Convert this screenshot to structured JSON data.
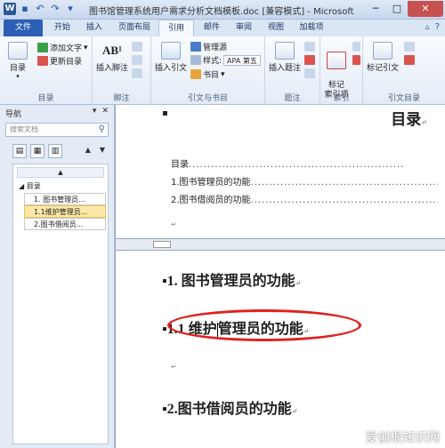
{
  "window": {
    "title": "图书馆管理系统用户需求分析文档模板.doc [兼容模式] - Microsoft Word",
    "logo": "W"
  },
  "tabs": {
    "file": "文件",
    "items": [
      "开始",
      "插入",
      "页面布局",
      "引用",
      "邮件",
      "审阅",
      "视图",
      "加载项"
    ],
    "active": "引用"
  },
  "ribbon": {
    "toc_group": {
      "label": "目录",
      "toc_button": "目录",
      "add_text": "添加文字",
      "update_toc": "更新目录"
    },
    "footnote_group": {
      "label": "脚注",
      "insert_footnote": "插入脚注"
    },
    "citations_group": {
      "label": "引文与书目",
      "insert_citation": "插入引文",
      "manage_sources": "管理源",
      "style_label": "样式:",
      "style_value": "APA 第五",
      "bibliography": "书目"
    },
    "captions_group": {
      "label": "题注",
      "insert_caption": "插入题注"
    },
    "index_group": {
      "label": "索引",
      "mark_entry": "标记\n索引项"
    },
    "toa_group": {
      "label": "引文目录",
      "mark_citation": "标记引文"
    }
  },
  "nav": {
    "title": "导航",
    "search_placeholder": "搜索文档",
    "tree": {
      "root": "目录",
      "items": [
        {
          "label": "1. 图书管理员...",
          "selected": false
        },
        {
          "label": "1.1维护管理员...",
          "selected": true
        },
        {
          "label": "2.图书借阅员...",
          "selected": false
        }
      ]
    }
  },
  "document": {
    "toc_heading": "目录",
    "toc_entries": [
      {
        "text": "目录",
        "page": ""
      },
      {
        "text": "1.图书管理员的功能",
        "page": ""
      },
      {
        "text": "2.图书借阅员的功能",
        "page": ""
      }
    ],
    "heading1": "1. 图书管理员的功能",
    "heading2_before_cursor": "1.1 维护",
    "heading2_after_cursor": "管理员的功能",
    "heading3": "2.图书借阅员的功能",
    "para_mark": "↵",
    "bullet": "▪"
  },
  "watermark": "爱创根知识网"
}
